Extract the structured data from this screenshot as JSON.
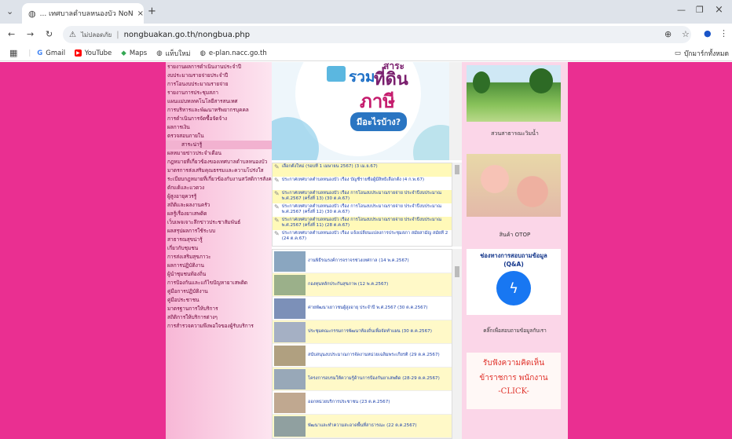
{
  "browser": {
    "tab_title": "... เทศบาลตำบลหนองบัว NoNGBUA",
    "url_secure_label": "ไม่ปลอดภัย",
    "url": "nongbuakan.go.th/nongbua.php",
    "bookmarks": [
      "Gmail",
      "YouTube",
      "Maps",
      "แท็บใหม่",
      "e-plan.nacc.go.th"
    ],
    "bookmarks_all": "บุ๊กมาร์กทั้งหมด"
  },
  "left_menu": {
    "items_top": [
      "รายงานผลการดำเนินงานประจำปี",
      "งบประมาณรายจ่ายประจำปี",
      "การโอนงบประมาณรายจ่าย",
      "รายงานการประชุมสภา",
      "แผนแม่บทเทคโนโลยีสารสนเทศ",
      "การบริหารและพัฒนาทรัพยากรบุคคล",
      "การดำเนินการจัดซื้อจัดจ้าง",
      "ผลการเงิน",
      "ตรวจสอบภายใน"
    ],
    "section_header": "สาระน่ารู้",
    "items_bottom": [
      "ผลหมายข่าวประจำเดือน",
      "กฎหมายที่เกี่ยวข้องของเทศบาลตำบลหนองบัว",
      "มาตรการส่งเสริมคุณธรรมและความโปร่งใส",
      "ระเบียบกฎหมายที่เกี่ยวข้องกับงานสวัสดิการสังคม",
      "ดักแด้และแวดวง",
      "ผู้สูงอายุควรรู้",
      "สถิติและผลงานครัว",
      "ผลรู้เรื่องยาเสพติด",
      "เว็บเพจเจาะลึกข่าวประชาสัมพันธ์",
      "ผลสรุปผลการใช้ระบบ",
      "สาธารณสุขน่ารู้",
      "เกี่ยวกับชุมชน",
      "การส่งเสริมสุขภาวะ",
      "ผลการปฏิบัติงาน",
      "ผู้นำชุมชนท้องถิ่น",
      "การป้องกันและแก้ไขปัญหายาเสพติด",
      "คู่มือการปฏิบัติงาน",
      "คู่มือประชาชน",
      "มาตรฐานการให้บริการ",
      "สถิติการให้บริการต่างๆ",
      "การสำรวจความพึงพอใจของผู้รับบริการ"
    ]
  },
  "center": {
    "banner": {
      "rom": "รวม",
      "sara": "สาระ",
      "thidin": "ที่ดิน",
      "phasi": "ภาษี",
      "question": "มีอะไรบ้าง?"
    },
    "news": [
      "เลือกตั้งใหม่ (รอบที่ 1 เมษายน 2567) (3 เม.ย.67)",
      "ประกาศเทศบาลตำบลหนองบัว เรื่อง บัญชีรายชื่อผู้มีสิทธิเลือกตั้ง (4 ก.พ.67)",
      "ประกาศเทศบาลตำบลหนองบัว เรื่อง การโอนงบประมาณรายจ่าย ประจำปีงบประมาณ พ.ศ.2567 (ครั้งที่ 13) (30 ต.ค.67)",
      "ประกาศเทศบาลตำบลหนองบัว เรื่อง การโอนงบประมาณรายจ่าย ประจำปีงบประมาณ พ.ศ.2567 (ครั้งที่ 12) (30 ต.ค.67)",
      "ประกาศเทศบาลตำบลหนองบัว เรื่อง การโอนงบประมาณรายจ่าย ประจำปีงบประมาณ พ.ศ.2567 (ครั้งที่ 11) (28 ต.ค.67)",
      "ประกาศเทศบาลตำบลหนองบัว เรื่อง แจ้งเปลี่ยนแปลงการประชุมสภา สมัยสามัญ สมัยที่ 2 (24 ต.ค.67)"
    ],
    "activities": [
      "งานพิธีรณรงค์การจราจรช่วงเทศกาล (14 พ.ค.2567)",
      "กองทุนหลักประกันสุขภาพ (12 พ.ค.2567)",
      "ค่ายพัฒนาเยาวชนผู้สูงอายุ ประจำปี พ.ศ.2567 (30 ต.ค.2567)",
      "ประชุมคณะกรรมการพัฒนาท้องถิ่นเพื่อจัดทำแผน (30 ต.ค.2567)",
      "สนับสนุนงบประมาณการจัดงานหน่วยเฉลิมพระเกียรติ (29 ต.ค.2567)",
      "โครงการอบรมให้ความรู้ด้านการป้องกันยาเสพติด (28-29 ต.ค.2567)",
      "ออกหน่วยบริการประชาชน (23 ต.ค.2567)",
      "พัฒนาและทำความสะอาดพื้นที่สาธารณะ (22 ต.ค.2567)"
    ]
  },
  "right": {
    "park_caption": "สวนสาธารณะวิมน้ำ",
    "otop_caption": "สินค้า OTOP",
    "chat_title": "ช่องทางการสอบถามข้อมูล",
    "chat_sub": "(Q&A)",
    "chat_caption": "คลิ๊กเพื่อสอบถามข้อมูลกับเรา",
    "ad_line1": "รับฟังความคิดเห็น",
    "ad_line2": "ข้าราชการ พนักงาน",
    "ad_line3": "-CLICK-"
  }
}
